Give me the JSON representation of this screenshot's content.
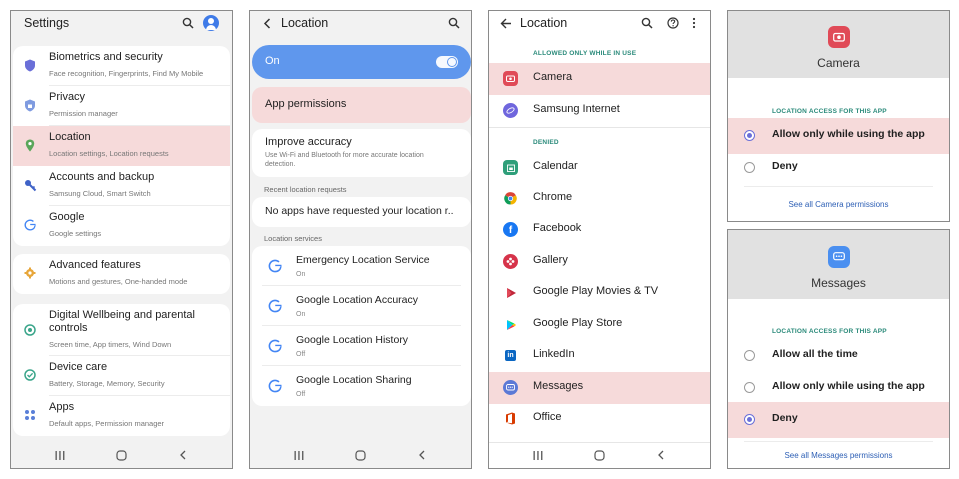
{
  "settings": {
    "title": "Settings",
    "groups": [
      [
        {
          "label": "Biometrics and security",
          "sub": "Face recognition, Fingerprints, Find My Mobile",
          "icon": "shield-icon",
          "color": "#6a6fd8"
        },
        {
          "label": "Privacy",
          "sub": "Permission manager",
          "icon": "privacy-shield-icon",
          "color": "#6a8fd8"
        },
        {
          "label": "Location",
          "sub": "Location settings, Location requests",
          "icon": "location-pin-icon",
          "color": "#5aa65a"
        },
        {
          "label": "Accounts and backup",
          "sub": "Samsung Cloud, Smart Switch",
          "icon": "key-icon",
          "color": "#3f62c7"
        },
        {
          "label": "Google",
          "sub": "Google settings",
          "icon": "google-icon",
          "color": "#4285f4"
        }
      ],
      [
        {
          "label": "Advanced features",
          "sub": "Motions and gestures, One-handed mode",
          "icon": "gear-plus-icon",
          "color": "#e7a63a"
        }
      ],
      [
        {
          "label": "Digital Wellbeing and parental controls",
          "sub": "Screen time, App timers, Wind Down",
          "icon": "wellbeing-icon",
          "color": "#3aa58a"
        },
        {
          "label": "Device care",
          "sub": "Battery, Storage, Memory, Security",
          "icon": "device-care-icon",
          "color": "#3aa58a"
        },
        {
          "label": "Apps",
          "sub": "Default apps, Permission manager",
          "icon": "apps-grid-icon",
          "color": "#5a7fd8"
        }
      ]
    ]
  },
  "location": {
    "title": "Location",
    "toggle_label": "On",
    "app_permissions": "App permissions",
    "improve_title": "Improve accuracy",
    "improve_sub": "Use Wi-Fi and Bluetooth for more accurate location detection.",
    "recent_label": "Recent location requests",
    "recent_text": "No apps have requested your location r..",
    "services_label": "Location services",
    "services": [
      {
        "label": "Emergency Location Service",
        "sub": "On"
      },
      {
        "label": "Google Location Accuracy",
        "sub": "On"
      },
      {
        "label": "Google Location History",
        "sub": "Off"
      },
      {
        "label": "Google Location Sharing",
        "sub": "Off"
      }
    ]
  },
  "app_list": {
    "title": "Location",
    "allowed_label": "ALLOWED ONLY WHILE IN USE",
    "allowed": [
      {
        "label": "Camera",
        "color": "#e04a57"
      },
      {
        "label": "Samsung Internet",
        "color": "#6f66dd"
      }
    ],
    "denied_label": "DENIED",
    "denied": [
      {
        "label": "Calendar",
        "color": "#2f9f7a"
      },
      {
        "label": "Chrome",
        "color": "#ffffff"
      },
      {
        "label": "Facebook",
        "color": "#1877f2"
      },
      {
        "label": "Gallery",
        "color": "#d6334a"
      },
      {
        "label": "Google Play Movies & TV",
        "color": "#ffffff"
      },
      {
        "label": "Google Play Store",
        "color": "#ffffff"
      },
      {
        "label": "LinkedIn",
        "color": "#ffffff"
      },
      {
        "label": "Messages",
        "color": "#5b79d6"
      },
      {
        "label": "Office",
        "color": "#ffffff"
      }
    ]
  },
  "camera_dialog": {
    "title": "Camera",
    "caption": "LOCATION ACCESS FOR THIS APP",
    "options": [
      "Allow only while using the app",
      "Deny"
    ],
    "link": "See all Camera permissions"
  },
  "messages_dialog": {
    "title": "Messages",
    "caption": "LOCATION ACCESS FOR THIS APP",
    "options": [
      "Allow all the time",
      "Allow only while using the app",
      "Deny"
    ],
    "link": "See all Messages permissions"
  }
}
